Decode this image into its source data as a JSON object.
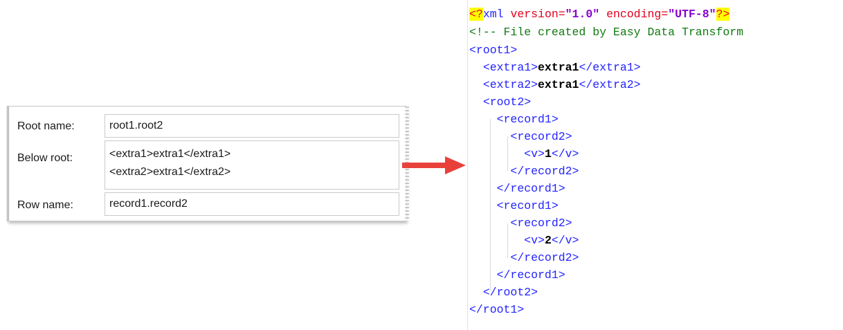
{
  "form": {
    "root_name": {
      "label": "Root name:",
      "value": "root1.root2"
    },
    "below_root": {
      "label": "Below root:",
      "lines": [
        "<extra1>extra1</extra1>",
        "<extra2>extra1</extra2>"
      ]
    },
    "row_name": {
      "label": "Row name:",
      "value": "record1.record2"
    }
  },
  "arrow": {
    "color": "#e8413a"
  },
  "xml": {
    "decl": {
      "open": "<?",
      "name": "xml",
      "version_attr": "version=",
      "version_val": "\"1.0\"",
      "encoding_attr": "encoding=",
      "encoding_val": "\"UTF-8\"",
      "close": "?>"
    },
    "comment": "<!-- File created by Easy Data Transform",
    "lines": [
      {
        "open": "<root1>"
      },
      {
        "open": "<extra1>",
        "text": "extra1",
        "close": "</extra1>"
      },
      {
        "open": "<extra2>",
        "text": "extra1",
        "close": "</extra2>"
      },
      {
        "open": "<root2>"
      },
      {
        "open": "<record1>"
      },
      {
        "open": "<record2>"
      },
      {
        "open": "<v>",
        "text": "1",
        "close": "</v>"
      },
      {
        "open": "</record2>"
      },
      {
        "open": "</record1>"
      },
      {
        "open": "<record1>"
      },
      {
        "open": "<record2>"
      },
      {
        "open": "<v>",
        "text": "2",
        "close": "</v>"
      },
      {
        "open": "</record2>"
      },
      {
        "open": "</record1>"
      },
      {
        "open": "</root2>"
      },
      {
        "open": "</root1>"
      }
    ]
  }
}
